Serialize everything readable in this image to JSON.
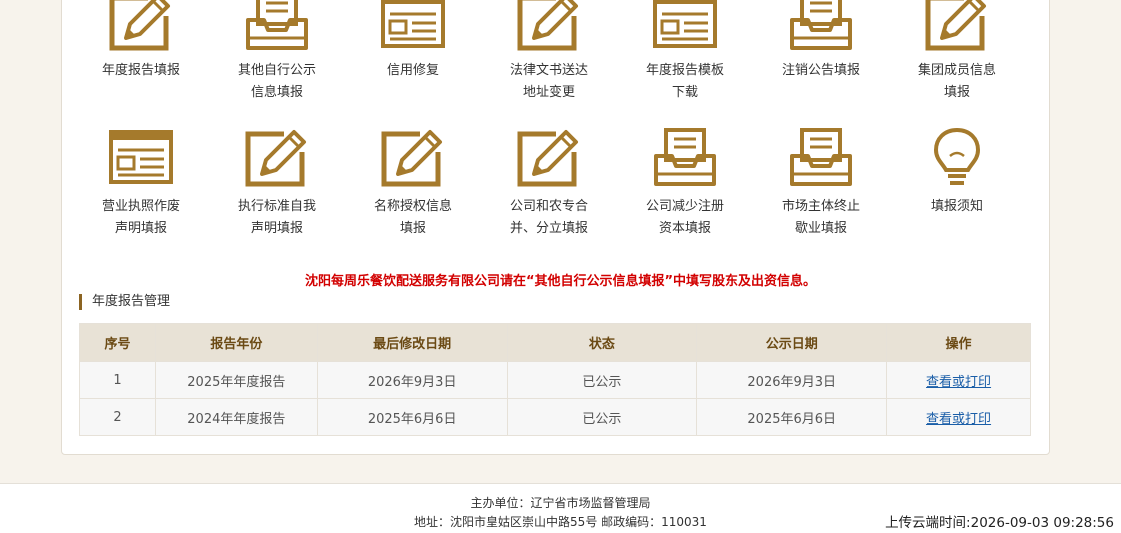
{
  "tiles": [
    {
      "label": "年度报告填报",
      "icon": "pen-edit-icon"
    },
    {
      "label": "其他自行公示\n信息填报",
      "icon": "inbox-tray-icon"
    },
    {
      "label": "信用修复",
      "icon": "form-window-icon"
    },
    {
      "label": "法律文书送达\n地址变更",
      "icon": "pen-edit-icon"
    },
    {
      "label": "年度报告模板\n下载",
      "icon": "form-window-icon"
    },
    {
      "label": "注销公告填报",
      "icon": "inbox-tray-icon"
    },
    {
      "label": "集团成员信息\n填报",
      "icon": "pen-edit-icon"
    },
    {
      "label": "营业执照作废\n声明填报",
      "icon": "form-window-icon"
    },
    {
      "label": "执行标准自我\n声明填报",
      "icon": "pen-edit-icon"
    },
    {
      "label": "名称授权信息\n填报",
      "icon": "pen-edit-icon"
    },
    {
      "label": "公司和农专合\n并、分立填报",
      "icon": "pen-edit-icon"
    },
    {
      "label": "公司减少注册\n资本填报",
      "icon": "inbox-tray-icon"
    },
    {
      "label": "市场主体终止\n歇业填报",
      "icon": "inbox-tray-icon"
    },
    {
      "label": "填报须知",
      "icon": "lightbulb-icon"
    }
  ],
  "notice": "沈阳每周乐餐饮配送服务有限公司请在“其他自行公示信息填报”中填写股东及出资信息。",
  "section_title": "年度报告管理",
  "table": {
    "headers": [
      "序号",
      "报告年份",
      "最后修改日期",
      "状态",
      "公示日期",
      "操作"
    ],
    "rows": [
      [
        "1",
        "2025年年度报告",
        "2026年9月3日",
        "已公示",
        "2026年9月3日",
        "查看或打印"
      ],
      [
        "2",
        "2024年年度报告",
        "2025年6月6日",
        "已公示",
        "2025年6月6日",
        "查看或打印"
      ]
    ]
  },
  "footer": {
    "line1": "主办单位：辽宁省市场监督管理局",
    "line2": "地址：沈阳市皇姑区崇山中路55号 邮政编码：110031",
    "upload_time": "上传云端时间:2026-09-03 09:28:56"
  },
  "colors": {
    "accent": "#a57a2c",
    "notice": "#d20000",
    "link": "#1a5ea8"
  }
}
